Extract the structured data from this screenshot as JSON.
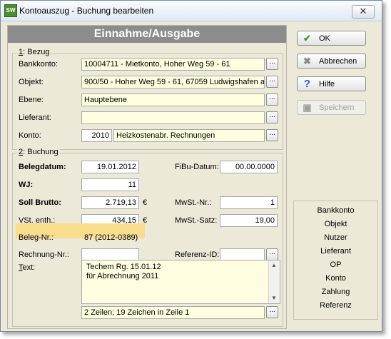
{
  "window": {
    "title": "Kontoauszug - Buchung bearbeiten",
    "app_icon_text": "SW",
    "close_glyph": "✕"
  },
  "header": "Einnahme/Ausgabe",
  "section1": {
    "label_prefix": "1",
    "label_rest": ": Bezug",
    "bankkonto": {
      "label": "Bankkonto:",
      "value": "10004711 - Mietkonto,  Hoher Weg 59 - 61"
    },
    "objekt": {
      "label": "Objekt:",
      "value": "900/50 - Hoher Weg 59 - 61, 67059 Ludwigshafen a."
    },
    "ebene": {
      "label": "Ebene:",
      "value": "Hauptebene"
    },
    "lieferant": {
      "label": "Lieferant:",
      "value": ""
    },
    "konto": {
      "label": "Konto:",
      "number": "2010",
      "name": "Heizkostenabr. Rechnungen"
    }
  },
  "section2": {
    "label_prefix": "2",
    "label_rest": ": Buchung",
    "belegdatum": {
      "label": "Belegdatum:",
      "value": "19.01.2012"
    },
    "fibu_datum": {
      "label": "FiBu-Datum:",
      "value": "00.00.0000"
    },
    "wj": {
      "label": "WJ:",
      "value": "11"
    },
    "soll_brutto": {
      "label": "Soll Brutto:",
      "value": "2.719,13",
      "unit": "€"
    },
    "mwst_nr": {
      "label": "MwSt.-Nr.:",
      "value": "1"
    },
    "vst_enth": {
      "label": "VSt. enth.:",
      "value": "434,15",
      "unit": "€"
    },
    "mwst_satz": {
      "label": "MwSt.-Satz:",
      "value": "19,00"
    },
    "beleg_nr": {
      "label": "Beleg-Nr.:",
      "value": "87 (2012-0389)"
    },
    "rechnung_nr": {
      "label": "Rechnung-Nr.:",
      "value": ""
    },
    "referenz_id": {
      "label": "Referenz-ID:",
      "value": ""
    },
    "text": {
      "label_prefix": "T",
      "label_rest": "ext:",
      "lines": [
        "Techem Rg. 15.01.12",
        "für Abrechnung 2011"
      ]
    },
    "status": "2 Zeilen; 19 Zeichen in Zeile 1"
  },
  "dots_label": "...",
  "buttons": {
    "ok": {
      "label": "OK",
      "icon": "check-icon"
    },
    "abbrechen": {
      "label": "Abbrechen",
      "icon": "x-icon"
    },
    "hilfe": {
      "label": "Hilfe",
      "icon": "question-icon"
    },
    "speichern": {
      "label": "Speichern",
      "icon": "floppy-icon"
    }
  },
  "nav_items": [
    "Bankkonto",
    "Objekt",
    "Nutzer",
    "Lieferant",
    "OP",
    "Konto",
    "Zahlung",
    "Referenz"
  ],
  "colors": {
    "header_bg": "#8c8c8c",
    "field_bg": "#fffde0",
    "highlight": "#f8dd8c",
    "ok_check": "#3a9a2a"
  }
}
